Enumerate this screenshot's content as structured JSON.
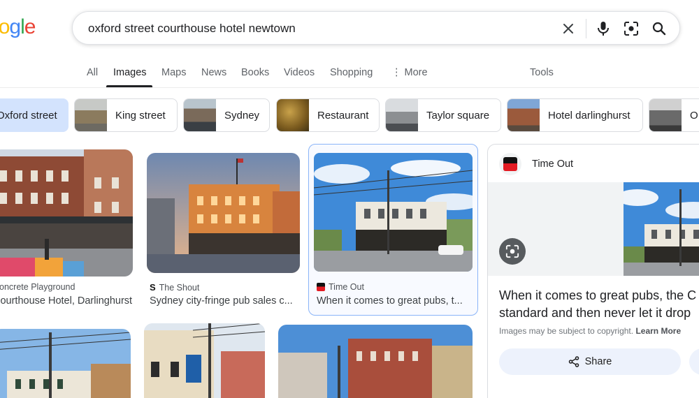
{
  "header": {
    "logo_letters": [
      "o",
      "o",
      "g",
      "l",
      "e"
    ],
    "search_query": "oxford street courthouse hotel newtown"
  },
  "tabs": [
    {
      "label": "All"
    },
    {
      "label": "Images"
    },
    {
      "label": "Maps"
    },
    {
      "label": "News"
    },
    {
      "label": "Books"
    },
    {
      "label": "Videos"
    },
    {
      "label": "Shopping"
    },
    {
      "label": "⋮ More"
    },
    {
      "label": "Tools"
    }
  ],
  "chips": [
    {
      "label": "Oxford street",
      "selected": true
    },
    {
      "label": "King street"
    },
    {
      "label": "Sydney"
    },
    {
      "label": "Restaurant"
    },
    {
      "label": "Taylor square"
    },
    {
      "label": "Hotel darlinghurst"
    },
    {
      "label": "O"
    }
  ],
  "results": [
    {
      "source": "Concrete Playground",
      "title": "Courthouse Hotel, Darlinghurst ..."
    },
    {
      "source": "The Shout",
      "title": "Sydney city-fringe pub sales c..."
    },
    {
      "source": "Time Out",
      "title": "When it comes to great pubs, t..."
    }
  ],
  "panel": {
    "source": "Time Out",
    "title_line1": "When it comes to great pubs, the C",
    "title_line2": "standard and then never let it drop",
    "copyright": "Images may be subject to copyright.",
    "learn_more": "Learn More",
    "share": "Share"
  },
  "colors": {
    "accent": "#1a73e8",
    "chip_selected": "#d3e3fd",
    "time_out_red": "#e31b23"
  }
}
